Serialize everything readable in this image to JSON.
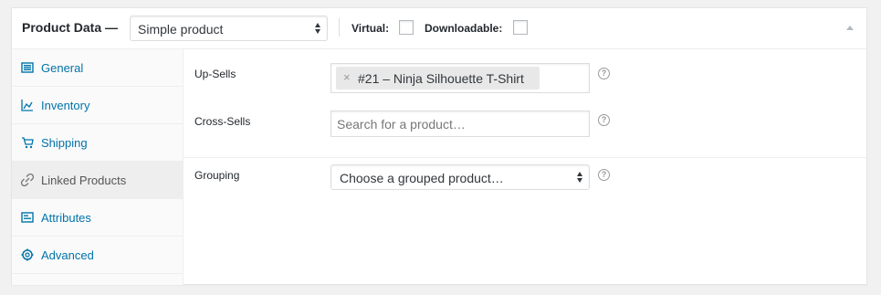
{
  "header": {
    "title": "Product Data —",
    "product_type": "Simple product",
    "virtual_label": "Virtual:",
    "downloadable_label": "Downloadable:",
    "virtual_checked": false,
    "downloadable_checked": false
  },
  "tabs": [
    {
      "label": "General",
      "icon": "general-icon",
      "active": false
    },
    {
      "label": "Inventory",
      "icon": "inventory-icon",
      "active": false
    },
    {
      "label": "Shipping",
      "icon": "shipping-icon",
      "active": false
    },
    {
      "label": "Linked Products",
      "icon": "link-icon",
      "active": true
    },
    {
      "label": "Attributes",
      "icon": "attributes-icon",
      "active": false
    },
    {
      "label": "Advanced",
      "icon": "gear-icon",
      "active": false
    }
  ],
  "linked": {
    "upsells": {
      "label": "Up-Sells",
      "chip_remove": "×",
      "chip": "#21 – Ninja Silhouette T-Shirt"
    },
    "crosssells": {
      "label": "Cross-Sells",
      "placeholder": "Search for a product…"
    },
    "grouping": {
      "label": "Grouping",
      "value": "Choose a grouped product…"
    },
    "help_glyph": "?"
  },
  "colors": {
    "link": "#0073aa",
    "active_tab_bg": "#eeeeee",
    "sidebar_bg": "#fafafa"
  }
}
